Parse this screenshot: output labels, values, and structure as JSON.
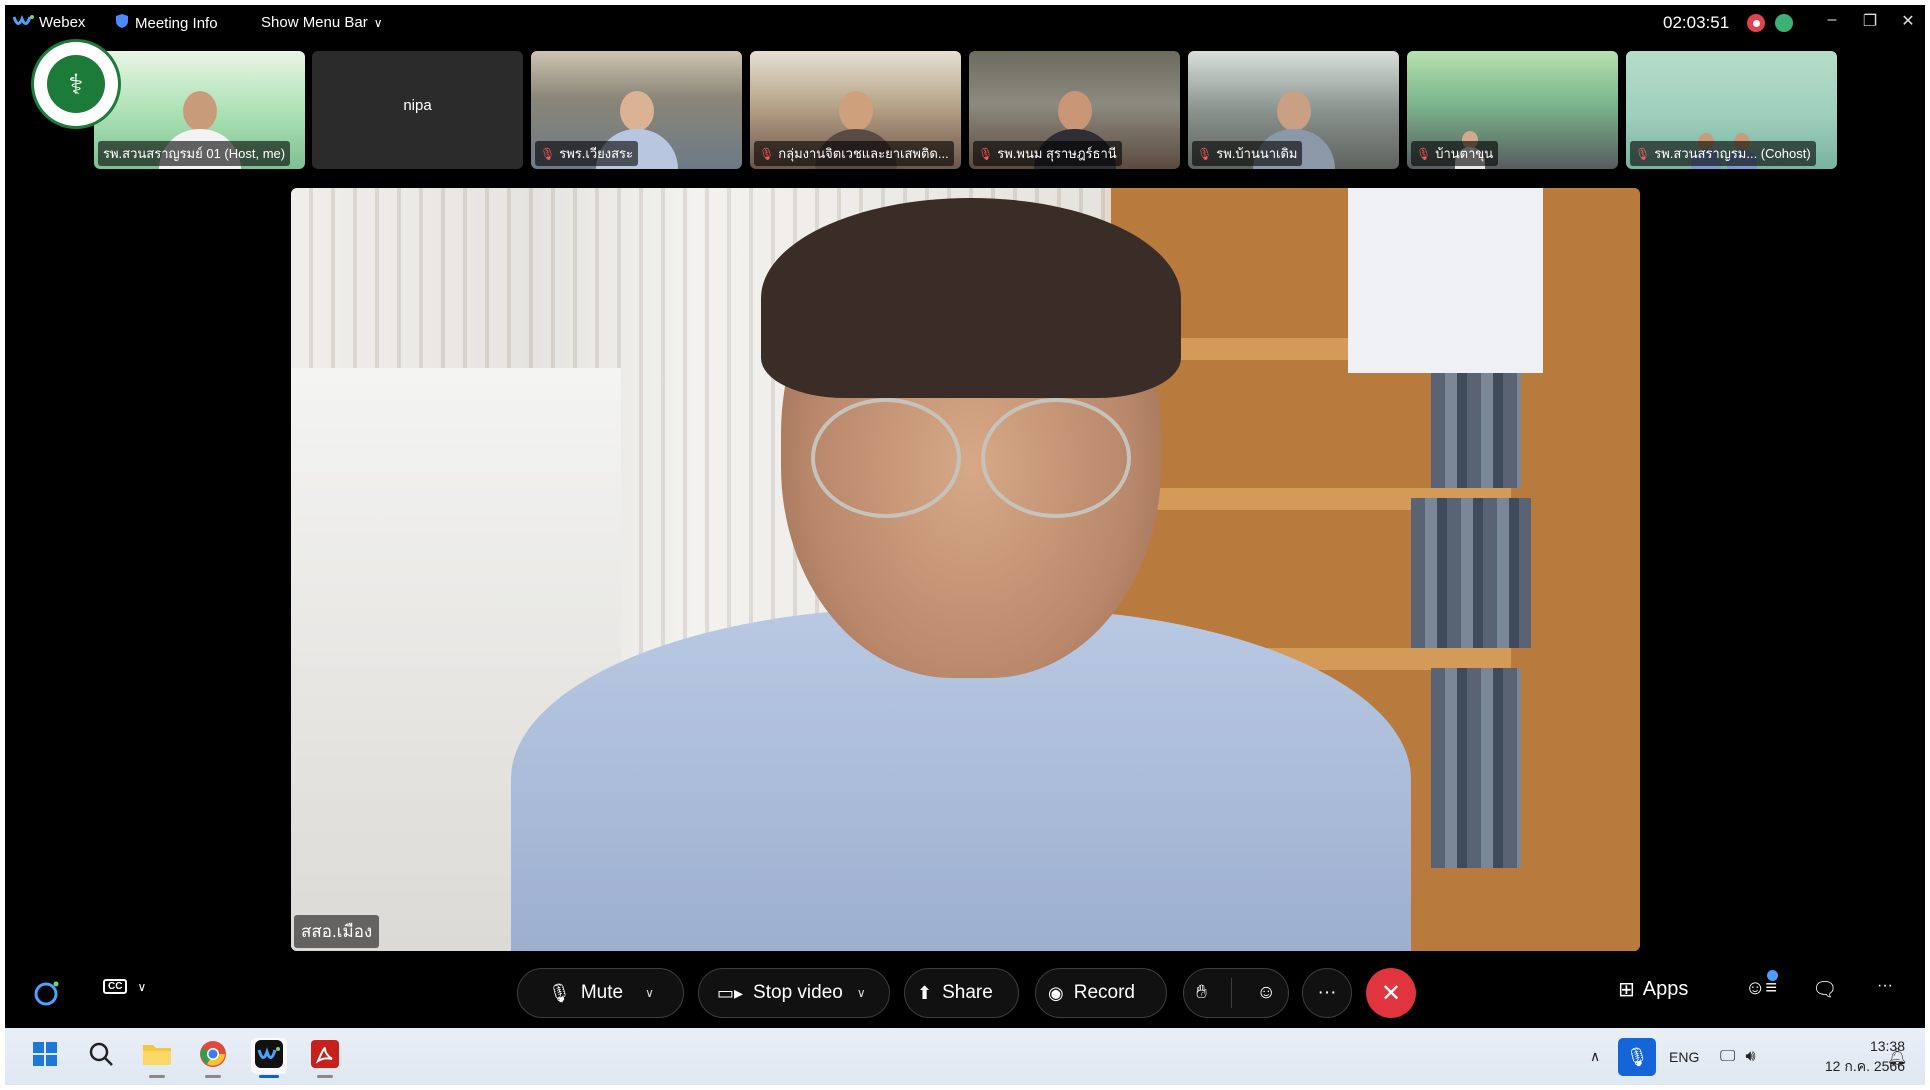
{
  "titlebar": {
    "app_name": "Webex",
    "meeting_info": "Meeting Info",
    "show_menu_bar": "Show Menu Bar",
    "timer": "02:03:51"
  },
  "participants": [
    {
      "name": "รพ.สวนสราญรมย์ 01 (Host, me)",
      "muted": false
    },
    {
      "name": "nipa",
      "muted": false
    },
    {
      "name": "รพร.เวียงสระ",
      "muted": true
    },
    {
      "name": "กลุ่มงานจิตเวชและยาเสพติด...",
      "muted": true
    },
    {
      "name": "รพ.พนม สุราษฎร์ธานี",
      "muted": true
    },
    {
      "name": "รพ.บ้านนาเดิม",
      "muted": true
    },
    {
      "name": "บ้านตาขุน",
      "muted": true
    },
    {
      "name": "รพ.สวนสราญรม... (Cohost)",
      "muted": true
    }
  ],
  "main_video": {
    "speaker_name": "สสอ.เมือง"
  },
  "controls": {
    "mute": "Mute",
    "stop_video": "Stop video",
    "share": "Share",
    "record": "Record",
    "more": "···",
    "apps": "Apps",
    "overflow": "···"
  },
  "taskbar": {
    "language": "ENG",
    "time": "13:38",
    "date": "12 ก.ค. 2566"
  },
  "colors": {
    "end_call": "#e0343f",
    "recording": "#e0434f",
    "accent_blue": "#1565d8"
  }
}
